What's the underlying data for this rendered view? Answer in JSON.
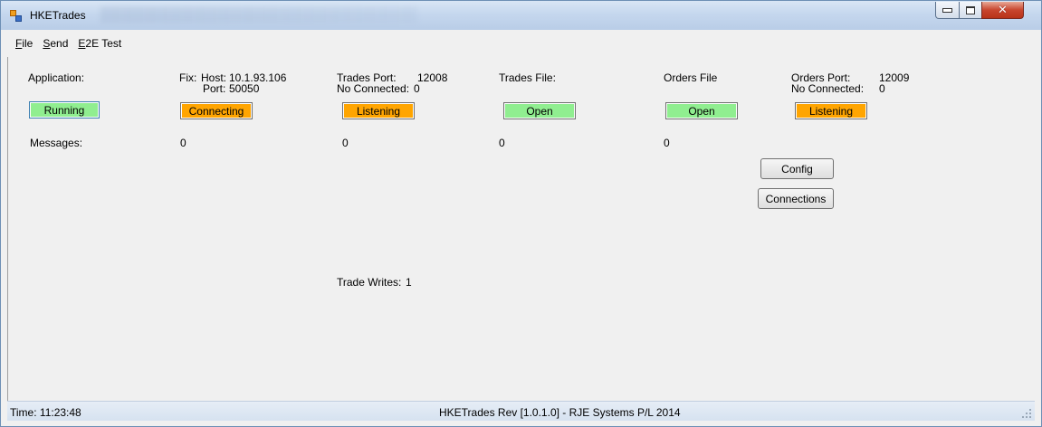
{
  "window": {
    "title": "HKETrades"
  },
  "menu": [
    {
      "key": "F",
      "rest": "ile"
    },
    {
      "key": "S",
      "rest": "end"
    },
    {
      "key": "E",
      "rest": "2E Test"
    }
  ],
  "application": {
    "label": "Application:",
    "status": "Running"
  },
  "fix": {
    "label": "Fix:",
    "host_label": "Host:",
    "host": "10.1.93.106",
    "port_label": "Port:",
    "port": "50050",
    "status": "Connecting"
  },
  "trades": {
    "port_label": "Trades Port:",
    "port": "12008",
    "connected_label": "No Connected:",
    "connected": "0",
    "status": "Listening"
  },
  "trades_file": {
    "label": "Trades File:",
    "status": "Open"
  },
  "orders_file": {
    "label": "Orders File",
    "status": "Open"
  },
  "orders": {
    "port_label": "Orders Port:",
    "port": "12009",
    "connected_label": "No Connected:",
    "connected": "0",
    "status": "Listening"
  },
  "messages": {
    "label": "Messages:",
    "fix": "0",
    "trades": "0",
    "trades_file": "0",
    "orders_file": "0"
  },
  "buttons": {
    "config": "Config",
    "connections": "Connections"
  },
  "trade_writes": {
    "label": "Trade Writes:",
    "value": "1"
  },
  "statusbar": {
    "time_label": "Time:",
    "time": "11:23:48",
    "rev": "HKETrades Rev [1.0.1.0] - RJE Systems P/L 2014"
  },
  "colors": {
    "running": "#90ee90",
    "listening": "#ffa500",
    "connecting": "#ffa500",
    "open": "#90ee90"
  }
}
